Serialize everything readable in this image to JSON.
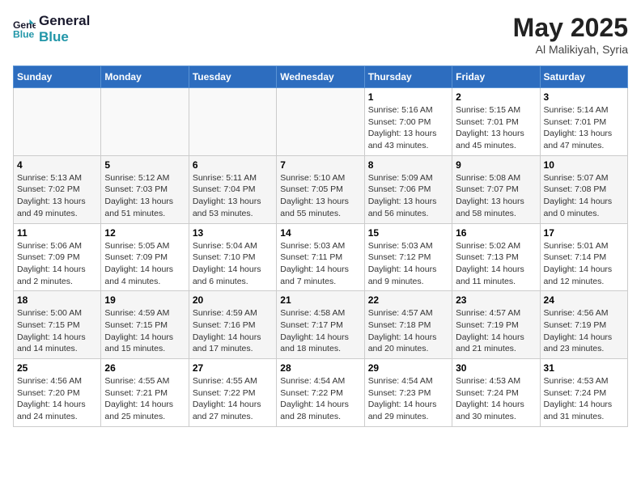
{
  "logo": {
    "line1": "General",
    "line2": "Blue"
  },
  "title": "May 2025",
  "location": "Al Malikiyah, Syria",
  "headers": [
    "Sunday",
    "Monday",
    "Tuesday",
    "Wednesday",
    "Thursday",
    "Friday",
    "Saturday"
  ],
  "weeks": [
    [
      {
        "day": "",
        "info": ""
      },
      {
        "day": "",
        "info": ""
      },
      {
        "day": "",
        "info": ""
      },
      {
        "day": "",
        "info": ""
      },
      {
        "day": "1",
        "info": "Sunrise: 5:16 AM\nSunset: 7:00 PM\nDaylight: 13 hours\nand 43 minutes."
      },
      {
        "day": "2",
        "info": "Sunrise: 5:15 AM\nSunset: 7:01 PM\nDaylight: 13 hours\nand 45 minutes."
      },
      {
        "day": "3",
        "info": "Sunrise: 5:14 AM\nSunset: 7:01 PM\nDaylight: 13 hours\nand 47 minutes."
      }
    ],
    [
      {
        "day": "4",
        "info": "Sunrise: 5:13 AM\nSunset: 7:02 PM\nDaylight: 13 hours\nand 49 minutes."
      },
      {
        "day": "5",
        "info": "Sunrise: 5:12 AM\nSunset: 7:03 PM\nDaylight: 13 hours\nand 51 minutes."
      },
      {
        "day": "6",
        "info": "Sunrise: 5:11 AM\nSunset: 7:04 PM\nDaylight: 13 hours\nand 53 minutes."
      },
      {
        "day": "7",
        "info": "Sunrise: 5:10 AM\nSunset: 7:05 PM\nDaylight: 13 hours\nand 55 minutes."
      },
      {
        "day": "8",
        "info": "Sunrise: 5:09 AM\nSunset: 7:06 PM\nDaylight: 13 hours\nand 56 minutes."
      },
      {
        "day": "9",
        "info": "Sunrise: 5:08 AM\nSunset: 7:07 PM\nDaylight: 13 hours\nand 58 minutes."
      },
      {
        "day": "10",
        "info": "Sunrise: 5:07 AM\nSunset: 7:08 PM\nDaylight: 14 hours\nand 0 minutes."
      }
    ],
    [
      {
        "day": "11",
        "info": "Sunrise: 5:06 AM\nSunset: 7:09 PM\nDaylight: 14 hours\nand 2 minutes."
      },
      {
        "day": "12",
        "info": "Sunrise: 5:05 AM\nSunset: 7:09 PM\nDaylight: 14 hours\nand 4 minutes."
      },
      {
        "day": "13",
        "info": "Sunrise: 5:04 AM\nSunset: 7:10 PM\nDaylight: 14 hours\nand 6 minutes."
      },
      {
        "day": "14",
        "info": "Sunrise: 5:03 AM\nSunset: 7:11 PM\nDaylight: 14 hours\nand 7 minutes."
      },
      {
        "day": "15",
        "info": "Sunrise: 5:03 AM\nSunset: 7:12 PM\nDaylight: 14 hours\nand 9 minutes."
      },
      {
        "day": "16",
        "info": "Sunrise: 5:02 AM\nSunset: 7:13 PM\nDaylight: 14 hours\nand 11 minutes."
      },
      {
        "day": "17",
        "info": "Sunrise: 5:01 AM\nSunset: 7:14 PM\nDaylight: 14 hours\nand 12 minutes."
      }
    ],
    [
      {
        "day": "18",
        "info": "Sunrise: 5:00 AM\nSunset: 7:15 PM\nDaylight: 14 hours\nand 14 minutes."
      },
      {
        "day": "19",
        "info": "Sunrise: 4:59 AM\nSunset: 7:15 PM\nDaylight: 14 hours\nand 15 minutes."
      },
      {
        "day": "20",
        "info": "Sunrise: 4:59 AM\nSunset: 7:16 PM\nDaylight: 14 hours\nand 17 minutes."
      },
      {
        "day": "21",
        "info": "Sunrise: 4:58 AM\nSunset: 7:17 PM\nDaylight: 14 hours\nand 18 minutes."
      },
      {
        "day": "22",
        "info": "Sunrise: 4:57 AM\nSunset: 7:18 PM\nDaylight: 14 hours\nand 20 minutes."
      },
      {
        "day": "23",
        "info": "Sunrise: 4:57 AM\nSunset: 7:19 PM\nDaylight: 14 hours\nand 21 minutes."
      },
      {
        "day": "24",
        "info": "Sunrise: 4:56 AM\nSunset: 7:19 PM\nDaylight: 14 hours\nand 23 minutes."
      }
    ],
    [
      {
        "day": "25",
        "info": "Sunrise: 4:56 AM\nSunset: 7:20 PM\nDaylight: 14 hours\nand 24 minutes."
      },
      {
        "day": "26",
        "info": "Sunrise: 4:55 AM\nSunset: 7:21 PM\nDaylight: 14 hours\nand 25 minutes."
      },
      {
        "day": "27",
        "info": "Sunrise: 4:55 AM\nSunset: 7:22 PM\nDaylight: 14 hours\nand 27 minutes."
      },
      {
        "day": "28",
        "info": "Sunrise: 4:54 AM\nSunset: 7:22 PM\nDaylight: 14 hours\nand 28 minutes."
      },
      {
        "day": "29",
        "info": "Sunrise: 4:54 AM\nSunset: 7:23 PM\nDaylight: 14 hours\nand 29 minutes."
      },
      {
        "day": "30",
        "info": "Sunrise: 4:53 AM\nSunset: 7:24 PM\nDaylight: 14 hours\nand 30 minutes."
      },
      {
        "day": "31",
        "info": "Sunrise: 4:53 AM\nSunset: 7:24 PM\nDaylight: 14 hours\nand 31 minutes."
      }
    ]
  ]
}
